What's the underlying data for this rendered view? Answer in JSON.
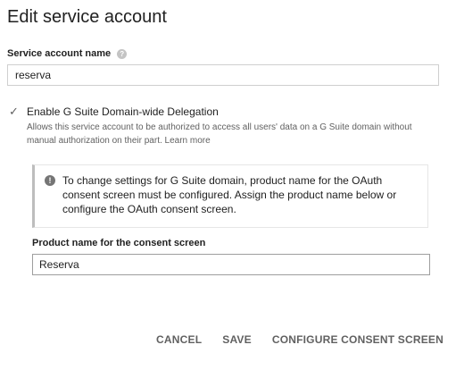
{
  "dialog": {
    "title": "Edit service account"
  },
  "service_account_name": {
    "label": "Service account name",
    "value": "reserva"
  },
  "delegation": {
    "checked": true,
    "label": "Enable G Suite Domain-wide Delegation",
    "description": "Allows this service account to be authorized to access all users' data on a G Suite domain without manual authorization on their part.",
    "learn_more": "Learn more"
  },
  "info": {
    "text": "To change settings for G Suite domain, product name for the OAuth consent screen must be configured. Assign the product name below or configure the OAuth consent screen."
  },
  "product_name": {
    "label": "Product name for the consent screen",
    "value": "Reserva"
  },
  "actions": {
    "cancel": "CANCEL",
    "save": "SAVE",
    "configure": "CONFIGURE CONSENT SCREEN"
  },
  "icons": {
    "help": "help-icon",
    "checkbox": "checkmark-icon",
    "info": "info-icon"
  }
}
